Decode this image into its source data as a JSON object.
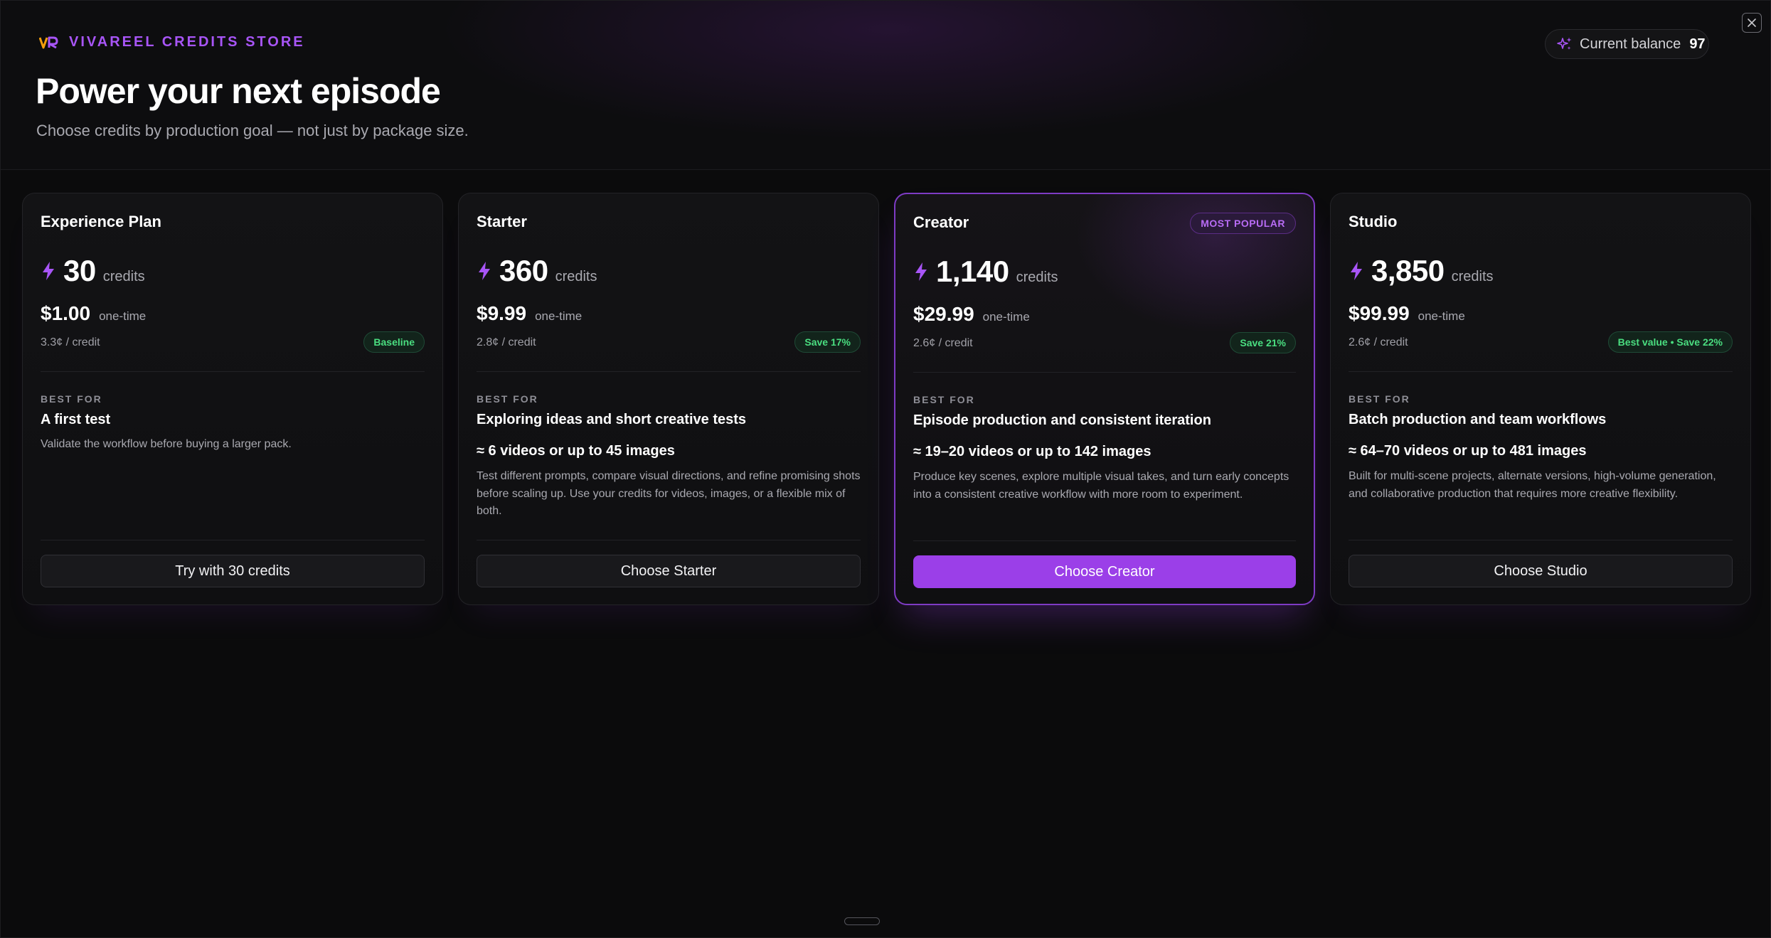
{
  "header": {
    "brand": "VIVAREEL CREDITS STORE",
    "title": "Power your next episode",
    "subtitle": "Choose credits by production goal — not just by package size.",
    "balance_label": "Current balance",
    "balance_value": "97"
  },
  "theme": {
    "accent": "#9b3fe8",
    "accent_text": "#a855f7",
    "save_green": "#4ade80",
    "background": "#0b0b0c"
  },
  "icons": {
    "logo": "vivareel-logo-icon",
    "sparkle": "sparkle-icon",
    "close": "close-icon",
    "bolt": "bolt-icon"
  },
  "plans": [
    {
      "name": "Experience Plan",
      "credits": "30",
      "credits_unit": "credits",
      "price": "$1.00",
      "price_note": "one-time",
      "per_credit": "3.3¢ / credit",
      "badge": "Baseline",
      "best_for_label": "BEST FOR",
      "best_for": "A first test",
      "best_for_sub": "Validate the workflow before buying a larger pack.",
      "cta": "Try with 30 credits"
    },
    {
      "name": "Starter",
      "credits": "360",
      "credits_unit": "credits",
      "price": "$9.99",
      "price_note": "one-time",
      "per_credit": "2.8¢ / credit",
      "badge": "Save 17%",
      "best_for_label": "BEST FOR",
      "best_for": "Exploring ideas and short creative tests",
      "approx": "≈ 6 videos or up to 45 images",
      "description": "Test different prompts, compare visual directions, and refine promising shots before scaling up. Use your credits for videos, images, or a flexible mix of both.",
      "cta": "Choose Starter"
    },
    {
      "name": "Creator",
      "popular": "MOST POPULAR",
      "credits": "1,140",
      "credits_unit": "credits",
      "price": "$29.99",
      "price_note": "one-time",
      "per_credit": "2.6¢ / credit",
      "badge": "Save 21%",
      "best_for_label": "BEST FOR",
      "best_for": "Episode production and consistent iteration",
      "approx": "≈ 19–20 videos or up to 142 images",
      "description": "Produce key scenes, explore multiple visual takes, and turn early concepts into a consistent creative workflow with more room to experiment.",
      "cta": "Choose Creator"
    },
    {
      "name": "Studio",
      "credits": "3,850",
      "credits_unit": "credits",
      "price": "$99.99",
      "price_note": "one-time",
      "per_credit": "2.6¢ / credit",
      "badge": "Best value • Save 22%",
      "best_for_label": "BEST FOR",
      "best_for": "Batch production and team workflows",
      "approx": "≈ 64–70 videos or up to 481 images",
      "description": "Built for multi-scene projects, alternate versions, high-volume generation, and collaborative production that requires more creative flexibility.",
      "cta": "Choose Studio"
    }
  ]
}
